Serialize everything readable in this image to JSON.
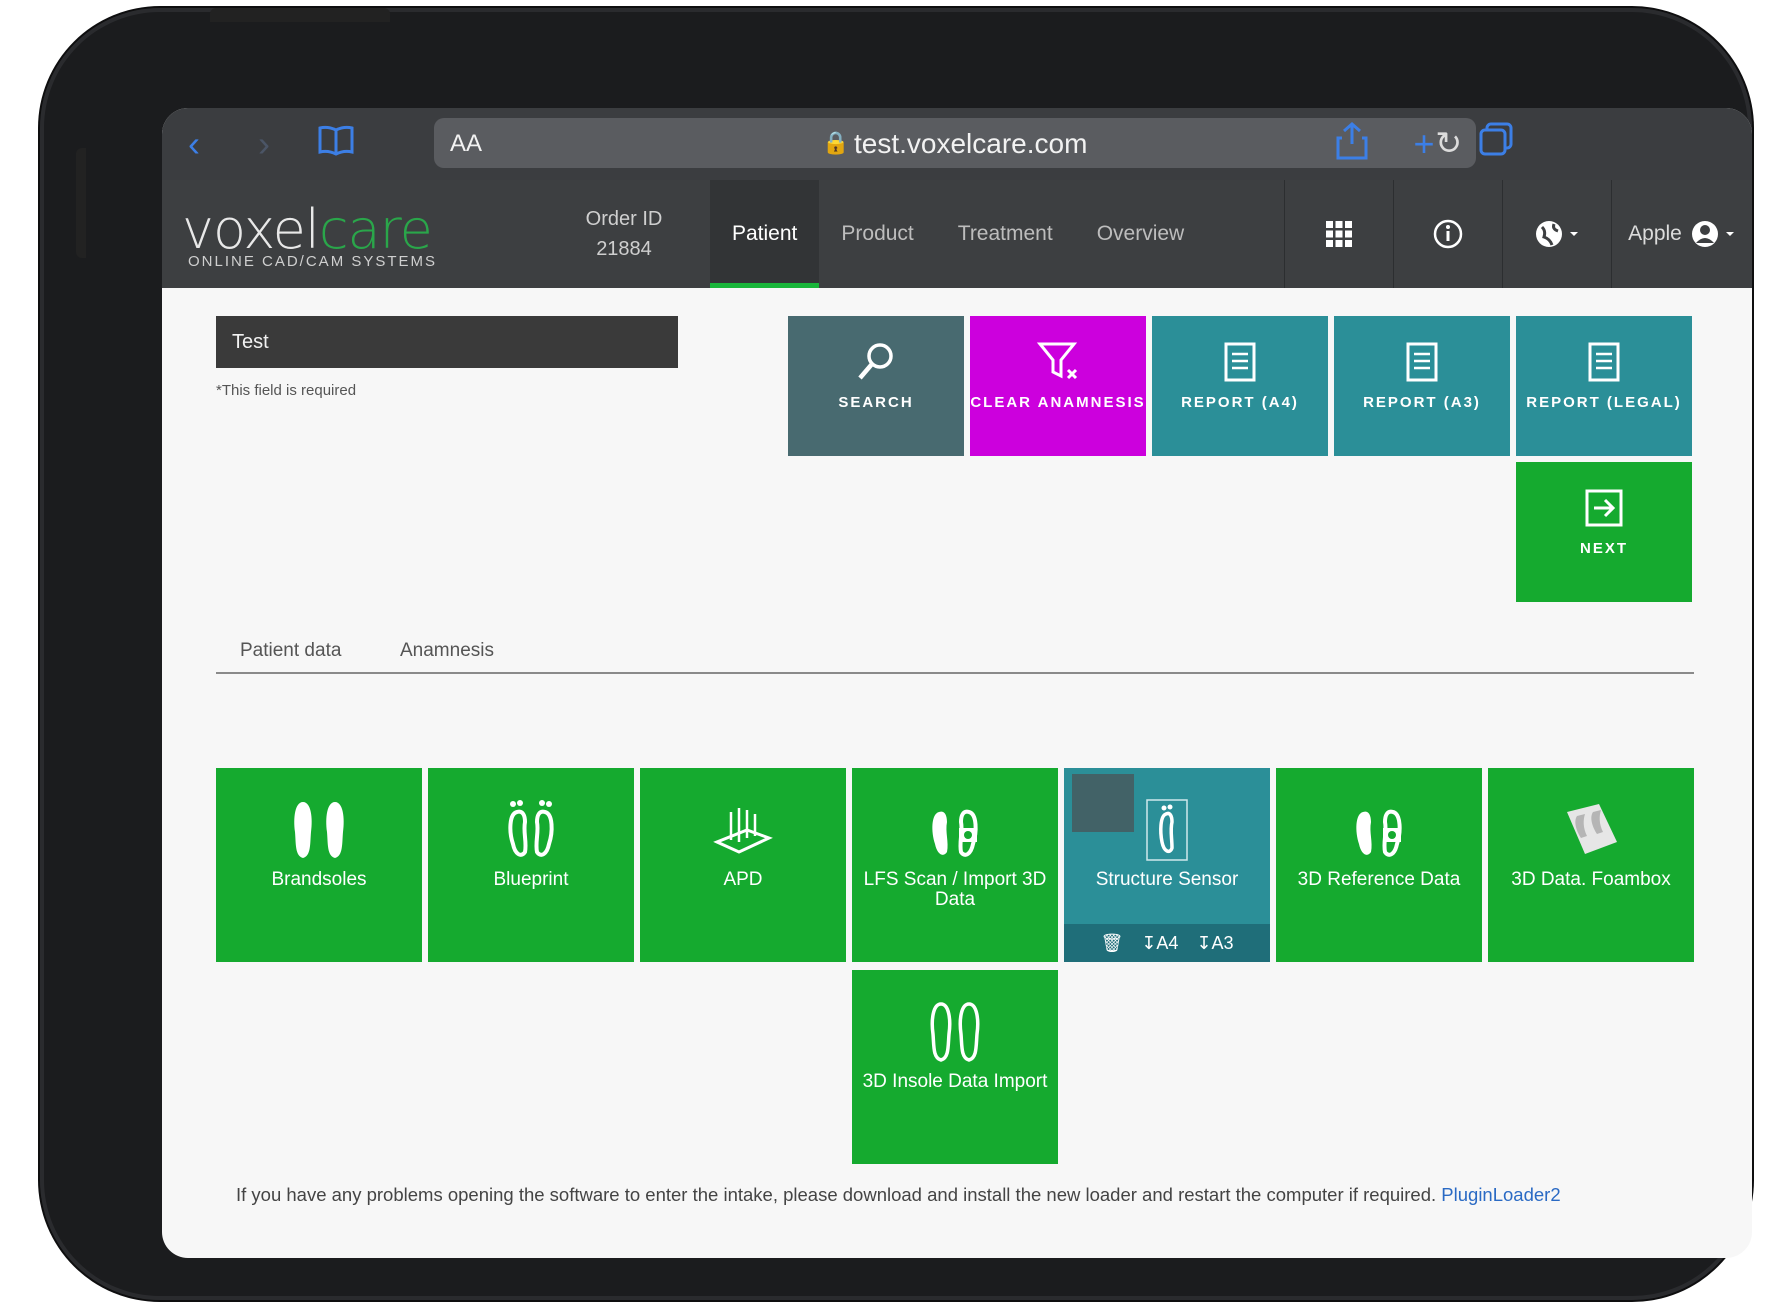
{
  "browser": {
    "url_prefix": "🔒",
    "url": "test.voxelcare.com",
    "aa_label": "AA"
  },
  "header": {
    "logo_primary": "voxel",
    "logo_accent": "care",
    "logo_tagline": "ONLINE CAD/CAM SYSTEMS",
    "order_label": "Order ID",
    "order_value": "21884",
    "tabs": [
      {
        "label": "Patient"
      },
      {
        "label": "Product"
      },
      {
        "label": "Treatment"
      },
      {
        "label": "Overview"
      }
    ],
    "user_label": "Apple"
  },
  "form": {
    "name_value": "Test",
    "required_note": "*This field is required"
  },
  "actions": {
    "search": "SEARCH",
    "clear": "CLEAR ANAMNESIS",
    "report_a4": "REPORT (A4)",
    "report_a3": "REPORT (A3)",
    "report_legal": "REPORT (LEGAL)",
    "next": "NEXT"
  },
  "subtabs": {
    "patient_data": "Patient data",
    "anamnesis": "Anamnesis"
  },
  "tiles": {
    "brandsoles": "Brandsoles",
    "blueprint": "Blueprint",
    "apd": "APD",
    "lfs_line1": "LFS Scan / Import 3D",
    "lfs_line2": "Data",
    "structure_sensor": "Structure Sensor",
    "a4": "A4",
    "a3": "A3",
    "reference": "3D Reference Data",
    "foambox": "3D Data. Foambox",
    "insole_import": "3D Insole Data Import"
  },
  "footer": {
    "text": "If you have any problems opening the software to enter the intake, please download and install the new loader and restart the computer if required.",
    "link": "PluginLoader2"
  },
  "colors": {
    "green": "#15aa2f",
    "magenta": "#cc00dd",
    "teal": "#2b8f98",
    "slate": "#486a70",
    "header": "#3d3f41"
  }
}
